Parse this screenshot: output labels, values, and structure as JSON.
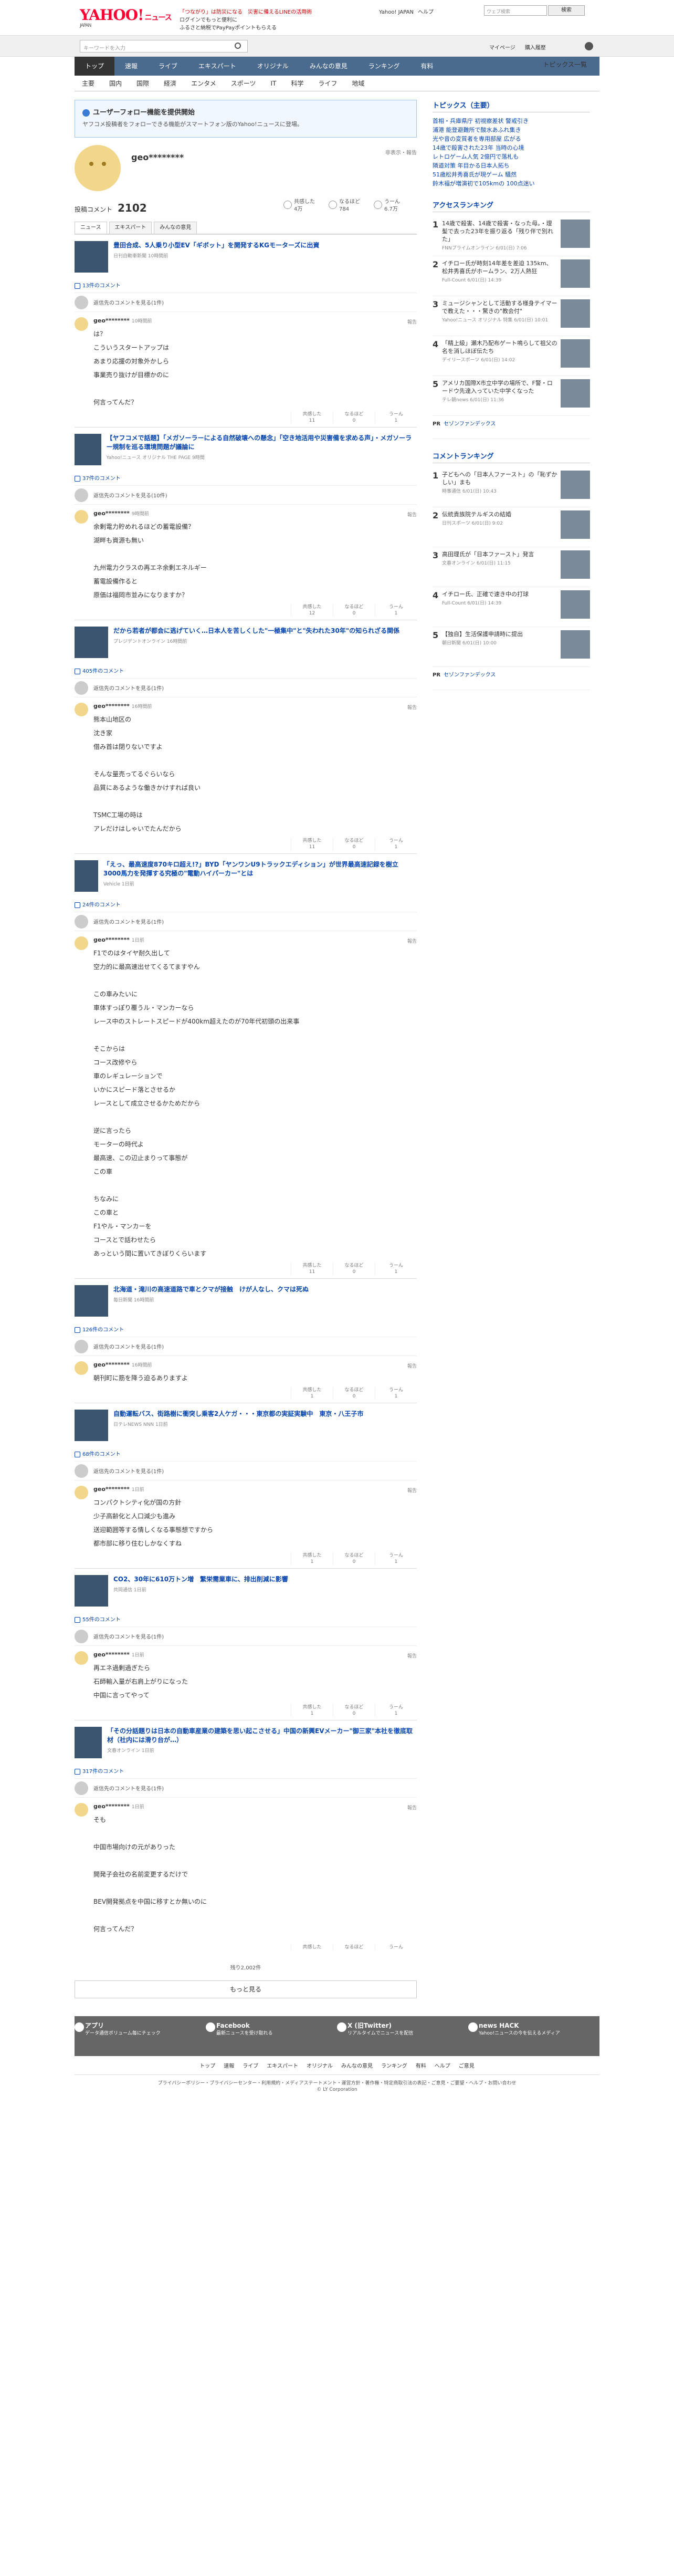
{
  "header": {
    "logo": "YAHOO!",
    "logo_sub": "ニュース",
    "logo_jp": "JAPAN",
    "promo1": "「つながり」は防災になる　災害に備えるLINEの活用術",
    "promo2": "ログインでもっと便利に",
    "promo3": "ふるさと納税でPayPayポイントもらえる",
    "links": [
      "Yahoo! JAPAN",
      "ヘルプ"
    ],
    "search_ph": "ウェブ検索",
    "search_btn": "検索"
  },
  "searchbar": {
    "placeholder": "キーワードを入力",
    "links": [
      "マイページ",
      "購入履歴"
    ]
  },
  "gnav": [
    "トップ",
    "速報",
    "ライブ",
    "エキスパート",
    "オリジナル",
    "みんなの意見",
    "ランキング",
    "有料"
  ],
  "snav": [
    "主要",
    "国内",
    "国際",
    "経済",
    "エンタメ",
    "スポーツ",
    "IT",
    "科学",
    "ライフ",
    "地域"
  ],
  "snav_right": "トピックス一覧",
  "banner": {
    "title": "ユーザーフォロー機能を提供開始",
    "body": "ヤフコメ投稿者をフォローできる機能がスマートフォン版のYahoo!ニュースに登場。"
  },
  "profile": {
    "name": "geo********",
    "flag": "非表示・報告",
    "count_label": "投稿コメント",
    "count": "2102",
    "stats": [
      {
        "label": "共感した",
        "v": "4万"
      },
      {
        "label": "なるほど",
        "v": "784"
      },
      {
        "label": "うーん",
        "v": "6.7万"
      }
    ]
  },
  "tabs": [
    "ニュース",
    "エキスパート",
    "みんなの意見"
  ],
  "articles": [
    {
      "title": "豊田合成、5人乗り小型EV「ギボット」を開発するKGモーターズに出資",
      "src": "日刊自動車新聞 10時間前",
      "count": "13件のコメント",
      "other": "返信先のコメントを見る(1件)",
      "date": "10時間前",
      "text": "は？\nこういうスタートアップは\nあまり応援の対象外かしら\n事業売り抜けが目標かのに\n\n何言ってんだ？",
      "re": [
        "11",
        "0",
        "1"
      ]
    },
    {
      "title": "【ヤフコメで話題】「メガソーラーによる自然破壊への懸念」「空き地活用や災害備を求める声」・メガソーラー規制を巡る環境問題が議論に",
      "src": "Yahoo!ニュース オリジナル THE PAGE 9時間",
      "count": "37件のコメント",
      "other": "返信先のコメントを見る(10件)",
      "date": "9時間前",
      "text": "余剰電力貯めれるほどの蓄電設備？\n湖畔も資源も無い\n\n九州電力クラスの再エネ余剰エネルギー\n蓄電設備作ると\n原価は福岡市並みになりますか？",
      "re": [
        "12",
        "0",
        "1"
      ]
    },
    {
      "title": "だから若者が都会に逃げていく…日本人を苦しくした\"一極集中\"と\"失われた30年\"の知られざる関係",
      "src": "プレジデントオンライン 16時間前",
      "count": "405件のコメント",
      "other": "返信先のコメントを見る(1件)",
      "date": "16時間前",
      "text": "熊本山地区の\n沈き家\n借み首は閉りないですよ\n\nそんな量売ってるぐらいなら\n品質にあるような働きかけすれば良い\n\nTSMC工場の時は\nアレだけはしゃいでたんだから",
      "re": [
        "11",
        "0",
        "1"
      ]
    },
    {
      "title": "「えっ、最高速度870キロ超え!?」BYD「ヤンワンU9トラックエディション」が世界最高速記録を樹立 3000馬力を発揮する究極の\"電動ハイパーカー\"とは",
      "src": "Vehicle 1日前",
      "count": "24件のコメント",
      "other": "返信先のコメントを見る(1件)",
      "date": "1日前",
      "text": "F1でのはタイヤ耐久出して\n空力的に最高速出せてくるてますやん\n\nこの車みたいに\n車体すっぽり覆うル・マンカーなら\nレース中のストレートスピードが400km超えたのが70年代初頭の出来事\n\nそこからは\nコース改修やら\n車のレギュレーションで\nいかにスピード落とさせるか\nレースとして成立させるかためだから\n\n逆に言ったら\nモーターの時代よ\n最高速、この辺止まりって事態が\nこの車\n\nちなみに\nこの車と\nF1やル・マンカーを\nコースとで話わせたら\nあっという間に置いてきぼりくらいます",
      "re": [
        "11",
        "0",
        "1"
      ]
    },
    {
      "title": "北海道・滝川の高速道路で車とクマが接触　けが人なし、クマは死ぬ",
      "src": "毎日新聞 16時間前",
      "count": "126件のコメント",
      "other": "返信先のコメントを見る(1件)",
      "date": "16時間前",
      "text": "朝刊町に筋を降う迫るありますよ",
      "re": [
        "1",
        "0",
        "1"
      ]
    },
    {
      "title": "自動運転バス、街路樹に衝突し乗客2人ケガ・・・東京都の実証実験中　東京・八王子市",
      "src": "日テレNEWS NNN 1日前",
      "count": "68件のコメント",
      "other": "返信先のコメントを見る(1件)",
      "date": "1日前",
      "text": "コンパクトシティ化が国の方針\n少子高齢化と人口減少も進み\n送迎範囲等する情しくなる事態想ですから\n都市部に移り住むしかなくすね",
      "re": [
        "1",
        "0",
        "1"
      ]
    },
    {
      "title": "CO2、30年に610万トン増　繁栄需業車に、排出削減に影響",
      "src": "共同通信 1日前",
      "count": "55件のコメント",
      "other": "返信先のコメントを見る(1件)",
      "date": "1日前",
      "text": "再エネ過剰過ぎたら\n石師輸入量が右肩上がりになった\n中国に言ってやって",
      "re": [
        "1",
        "0",
        "1"
      ]
    },
    {
      "title": "「その分話題りは日本の自動車産業の建築を思い起こさせる」中国の新興EVメーカー\"御三家\"本社を徹底取材（社内には滑り台が…）",
      "src": "文春オンライン 1日前",
      "count": "317件のコメント",
      "other": "返信先のコメントを見る(1件)",
      "date": "1日前",
      "text": "そも\n\n中国市場向けの元がありった\n\n開発子会社の名前変更するだけで\n\nBEV開発拠点を中国に移すとか無いのに\n\n何言ってんだ？",
      "re": [
        "",
        "",
        ""
      ]
    }
  ],
  "more": {
    "count": "残り2,002件",
    "label": "もっと見る"
  },
  "topics": {
    "title": "トピックス（主要）",
    "items": [
      "首相・兵庫県庁 初視察差状 警戒引き",
      "浦港 能登避難所で酸水あふれ集き",
      "光や音の変質者を専用部屋 広がる",
      "14歳で殺害された23年 当時の心境",
      "レトロゲーム人気 2億円で落札も",
      "隣道対策 年目かる日本人拓ち",
      "51歳松井秀喜氏が現ゲーム 騒然",
      "鈴木福が増演初で105kmの 100点迷い"
    ]
  },
  "access": {
    "title": "アクセスランキング",
    "items": [
      {
        "t": "14歳で殺害、14歳で殺害・なった母。・理髪で去った23年を振り返る「残り伴で別れた」",
        "s": "FNNプライムオンライン 6/01(日) 7:06"
      },
      {
        "t": "イチロー氏が時刻14年差を差迫 135km、松井秀喜氏がホームラン、2万人熱狂",
        "s": "Full-Count 6/01(日) 14:39"
      },
      {
        "t": "ミュージシャンとして活動する様身テイマーで教えた・・・驚きの\"教会付\"",
        "s": "Yahoo!ニュース オリジナル 特集 6/01(日) 10:01"
      },
      {
        "t": "「精上級」瀬木乃配布ゲート鳴らして祖父の名を消しほぼ伝たち",
        "s": "デイリースポーツ 6/01(日) 14:02"
      },
      {
        "t": "アメリカ国際X市立中学の場所で、F警・ロードウ先達入っていた中学くなった",
        "s": "テレ朝news 6/01(日) 11:36"
      }
    ],
    "pr": "PR",
    "pr_text": "セゾンファンデックス"
  },
  "comments": {
    "title": "コメントランキング",
    "items": [
      {
        "t": "子どもへの「日本人ファースト」の「恥ずかしい」まも",
        "s": "時事通信 6/01(日) 10:43"
      },
      {
        "t": "伝統貴族院テルギスの結婚",
        "s": "日刊スポーツ 6/01(日) 9:02"
      },
      {
        "t": "高田理氏が「日本ファースト」発言",
        "s": "文春オンライン 6/01(日) 11:15"
      },
      {
        "t": "イチロー氏、正確で速き中の打球",
        "s": "Full-Count 6/01(日) 14:39"
      },
      {
        "t": "【独自】生活保護申請時に提出",
        "s": "朝日新聞 6/01(日) 10:00"
      }
    ],
    "pr": "PR",
    "pr_text": "セゾンファンデックス"
  },
  "reactions": [
    "共感した",
    "なるほど",
    "うーん"
  ],
  "report": "報告",
  "footer": {
    "cols": [
      {
        "t": "アプリ",
        "d": "データ通信ボリューム毎にチェック"
      },
      {
        "t": "Facebook",
        "d": "最新ニュースを受け取れる"
      },
      {
        "t": "X (旧Twitter)",
        "d": "リアルタイムでニュースを配信"
      },
      {
        "t": "news HACK",
        "d": "Yahoo!ニュースの今を伝えるメディア"
      }
    ],
    "nav": [
      "トップ",
      "速報",
      "ライブ",
      "エキスパート",
      "オリジナル",
      "みんなの意見",
      "ランキング",
      "有料",
      "ヘルプ",
      "ご意見"
    ],
    "legal": "プライバシーポリシー・プライバシーセンター・利用規約・メディアステートメント・運営方針・著作権・特定商取引法の表記・ご意見・ご要望・ヘルプ・お問い合わせ",
    "copy": "© LY Corporation"
  }
}
